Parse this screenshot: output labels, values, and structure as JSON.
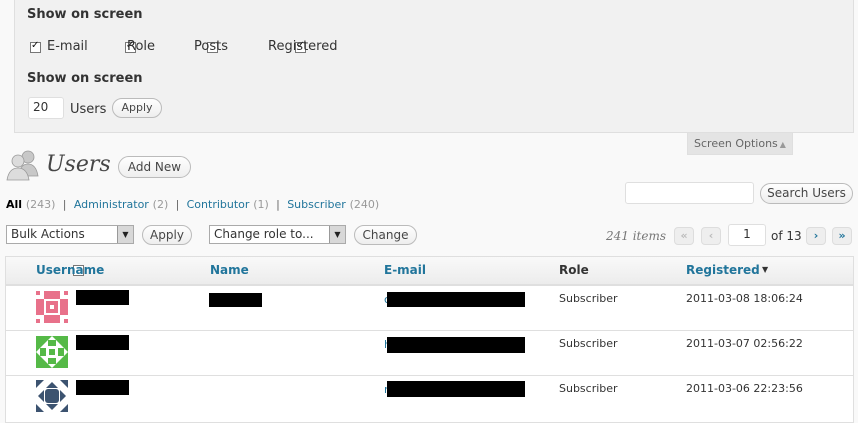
{
  "screen_options": {
    "heading_columns": "Show on screen",
    "columns": [
      {
        "label": "E-mail",
        "checked": true
      },
      {
        "label": "Role",
        "checked": true
      },
      {
        "label": "Posts",
        "checked": false
      },
      {
        "label": "Registered",
        "checked": true
      }
    ],
    "heading_pagination": "Show on screen",
    "per_page_value": "20",
    "per_page_unit": "Users",
    "apply_label": "Apply",
    "tab_label": "Screen Options"
  },
  "page": {
    "title": "Users",
    "add_new_label": "Add New"
  },
  "filters": [
    {
      "label": "All",
      "count": "(243)",
      "current": true
    },
    {
      "label": "Administrator",
      "count": "(2)",
      "current": false
    },
    {
      "label": "Contributor",
      "count": "(1)",
      "current": false
    },
    {
      "label": "Subscriber",
      "count": "(240)",
      "current": false
    }
  ],
  "search": {
    "value": "",
    "button_label": "Search Users"
  },
  "bulk": {
    "select_value": "Bulk Actions",
    "apply_label": "Apply",
    "role_select_value": "Change role to...",
    "change_label": "Change"
  },
  "pagination": {
    "items_text": "241 items",
    "first": "«",
    "prev": "‹",
    "current_page": "1",
    "of_text": "of 13",
    "next": "›",
    "last": "»"
  },
  "table": {
    "columns": {
      "username": "Username",
      "name": "Name",
      "email": "E-mail",
      "role": "Role",
      "registered": "Registered",
      "sort_indicator": "▼"
    },
    "rows": [
      {
        "role": "Subscriber",
        "registered": "2011-03-08 18:06:24",
        "avatar_color": "#e8718a",
        "email_prefix": "c"
      },
      {
        "role": "Subscriber",
        "registered": "2011-03-07 02:56:22",
        "avatar_color": "#55b947",
        "email_prefix": "h"
      },
      {
        "role": "Subscriber",
        "registered": "2011-03-06 22:23:56",
        "avatar_color": "#3c5370",
        "email_prefix": "n"
      }
    ]
  },
  "colors": {
    "link": "#21759b",
    "panel_bg": "#f1f1f1"
  }
}
